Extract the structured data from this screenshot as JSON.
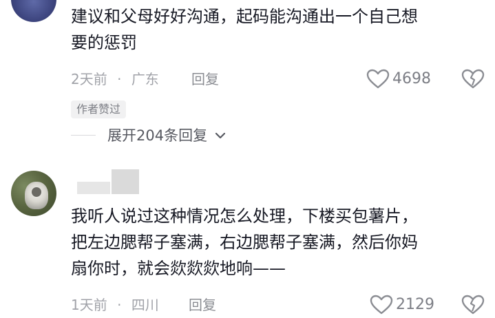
{
  "comments": [
    {
      "text_line1": "建议和父母好好沟通，起码能沟通出一个自己想",
      "text_line2": "要的惩罚",
      "time": "2天前",
      "sep": "·",
      "location": "广东",
      "reply_label": "回复",
      "likes": "4698",
      "author_liked_tag": "作者赞过",
      "expand_replies": "展开204条回复"
    },
    {
      "text_line1": "我听人说过这种情况怎么处理，下楼买包薯片，",
      "text_line2": "把左边腮帮子塞满，右边腮帮子塞满，然后你妈",
      "text_line3": "扇你时，就会欻欻欻地响——",
      "time": "1天前",
      "sep": "·",
      "location": "四川",
      "reply_label": "回复",
      "likes": "2129"
    }
  ],
  "colors": {
    "text": "#161823",
    "meta": "#a0a2a8",
    "icon": "#8a8c92"
  }
}
